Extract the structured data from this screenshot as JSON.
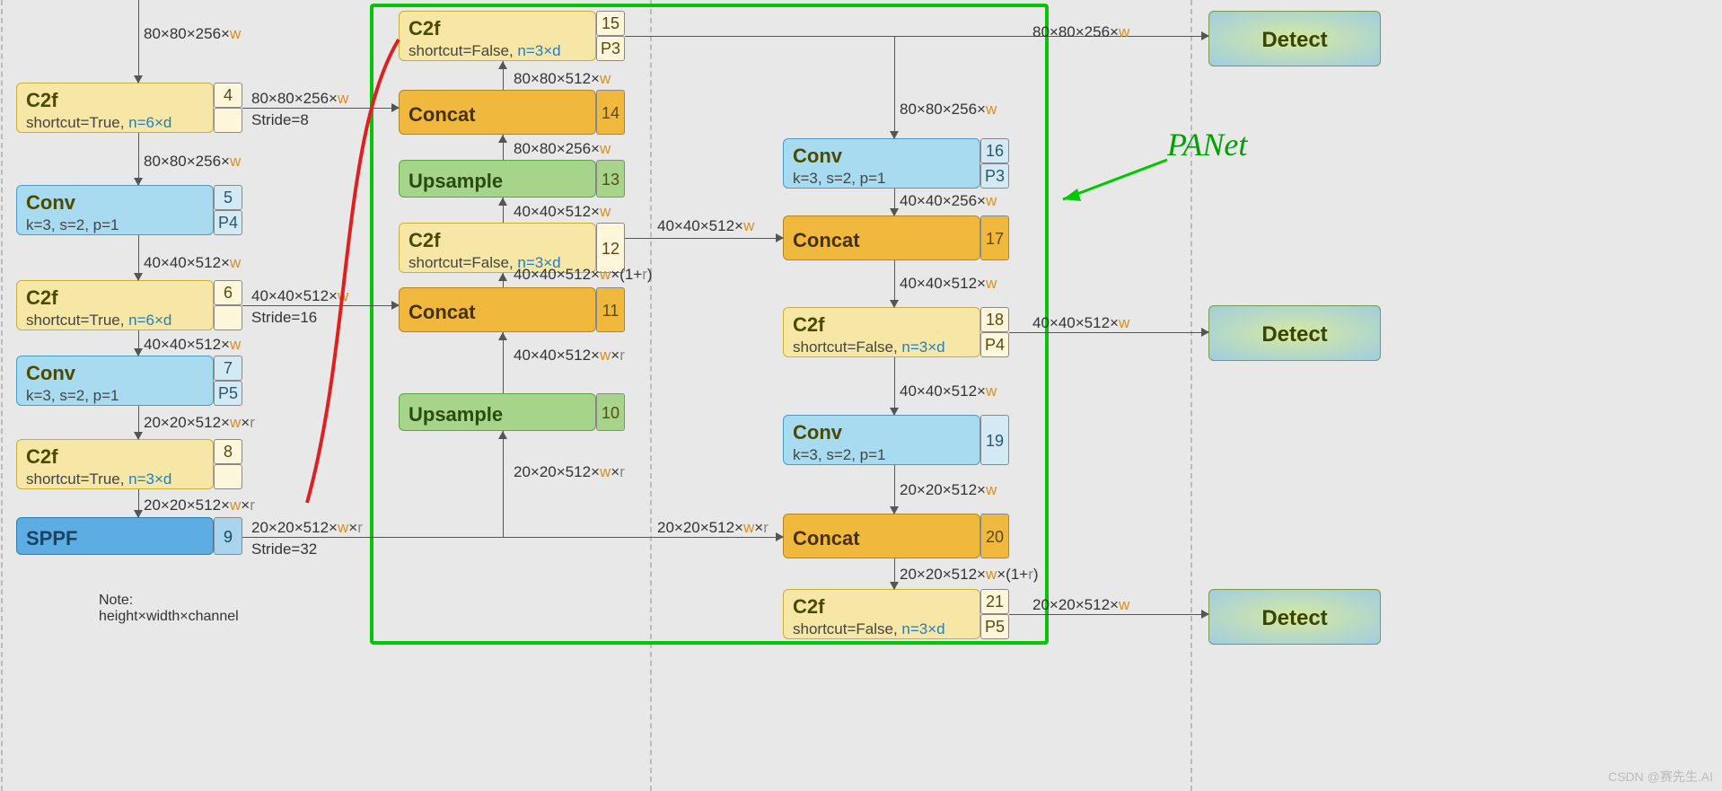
{
  "title_text": "PANet",
  "note": {
    "line1": "Note:",
    "line2": "height×width×channel"
  },
  "watermark": "CSDN @赛先生.AI",
  "col1": {
    "c2f4": {
      "title": "C2f",
      "sub_a": "shortcut=True, ",
      "sub_b": "n=6×d",
      "id": "4",
      "stride": "Stride=8"
    },
    "conv5": {
      "title": "Conv",
      "sub": "k=3, s=2, p=1",
      "id": "5",
      "p": "P4"
    },
    "c2f6": {
      "title": "C2f",
      "sub_a": "shortcut=True, ",
      "sub_b": "n=6×d",
      "id": "6",
      "stride": "Stride=16"
    },
    "conv7": {
      "title": "Conv",
      "sub": "k=3, s=2, p=1",
      "id": "7",
      "p": "P5"
    },
    "c2f8": {
      "title": "C2f",
      "sub_a": "shortcut=True, ",
      "sub_b": "n=3×d",
      "id": "8"
    },
    "sppf": {
      "title": "SPPF",
      "id": "9",
      "stride": "Stride=32"
    }
  },
  "col2": {
    "c2f15": {
      "title": "C2f",
      "sub_a": "shortcut=False, ",
      "sub_b": "n=3×d",
      "id": "15",
      "p": "P3"
    },
    "concat14": {
      "title": "Concat",
      "id": "14"
    },
    "up13": {
      "title": "Upsample",
      "id": "13"
    },
    "c2f12": {
      "title": "C2f",
      "sub_a": "shortcut=False, ",
      "sub_b": "n=3×d",
      "id": "12"
    },
    "concat11": {
      "title": "Concat",
      "id": "11"
    },
    "up10": {
      "title": "Upsample",
      "id": "10"
    }
  },
  "col3": {
    "conv16": {
      "title": "Conv",
      "sub": "k=3, s=2, p=1",
      "id": "16",
      "p": "P3"
    },
    "concat17": {
      "title": "Concat",
      "id": "17"
    },
    "c2f18": {
      "title": "C2f",
      "sub_a": "shortcut=False, ",
      "sub_b": "n=3×d",
      "id": "18",
      "p": "P4"
    },
    "conv19": {
      "title": "Conv",
      "sub": "k=3, s=2, p=1",
      "id": "19"
    },
    "concat20": {
      "title": "Concat",
      "id": "20"
    },
    "c2f21": {
      "title": "C2f",
      "sub_a": "shortcut=False, ",
      "sub_b": "n=3×d",
      "id": "21",
      "p": "P5"
    }
  },
  "detect": {
    "d1": "Detect",
    "d2": "Detect",
    "d3": "Detect"
  },
  "labels": {
    "l_top_col1": "80×80×256×w",
    "l_4_5": "80×80×256×w",
    "l_5_6": "40×40×512×w",
    "l_6_7": "40×40×512×w",
    "l_7_8": "20×20×512×w×r",
    "l_8_9": "20×20×512×w×r",
    "l_4_out": "80×80×256×w",
    "l_6_out": "40×40×512×w",
    "l_9_out": "20×20×512×w×r",
    "l_14_15": "80×80×512×w",
    "l_13_14": "80×80×256×w",
    "l_12_13": "40×40×512×w",
    "l_11_12": "40×40×512×w×(1+r)",
    "l_10_11": "40×40×512×w×r",
    "l_9_10": "20×20×512×w×r",
    "l_12_out": "40×40×512×w",
    "l_9_20": "20×20×512×w×r",
    "l_15_out": "80×80×256×w",
    "l_15_16": "80×80×256×w",
    "l_16_17": "40×40×256×w",
    "l_17_18": "40×40×512×w",
    "l_18_19": "40×40×512×w",
    "l_19_20": "20×20×512×w",
    "l_20_21": "20×20×512×w×(1+r)",
    "l_18_out": "40×40×512×w",
    "l_21_out": "20×20×512×w"
  }
}
